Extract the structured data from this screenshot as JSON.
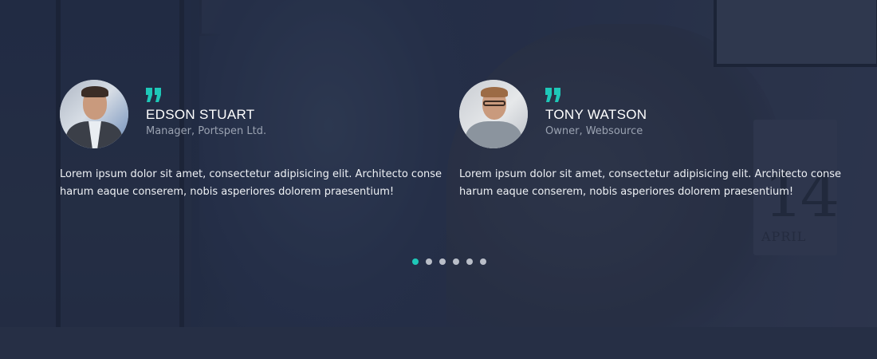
{
  "testimonials": [
    {
      "name": "EDSON STUART",
      "role": "Manager, Portspen Ltd.",
      "text": "Lorem ipsum dolor sit amet, consectetur adipisicing elit. Architecto conse harum eaque conserem, nobis asperiores dolorem praesentium!",
      "quote_icon": "quote-icon"
    },
    {
      "name": "TONY WATSON",
      "role": "Owner, Websource",
      "text": "Lorem ipsum dolor sit amet, consectetur adipisicing elit. Architecto conse harum eaque conserem, nobis asperiores dolorem praesentium!",
      "quote_icon": "quote-icon"
    }
  ],
  "background": {
    "calendar_number": "14",
    "calendar_month": "APRIL"
  },
  "pagination": {
    "count": 6,
    "active_index": 0
  },
  "colors": {
    "accent": "#1ec8b8",
    "overlay": "#1c263c",
    "name_text": "#ffffff",
    "role_text": "#9aa2b1",
    "dot_inactive": "#b9bec8"
  }
}
